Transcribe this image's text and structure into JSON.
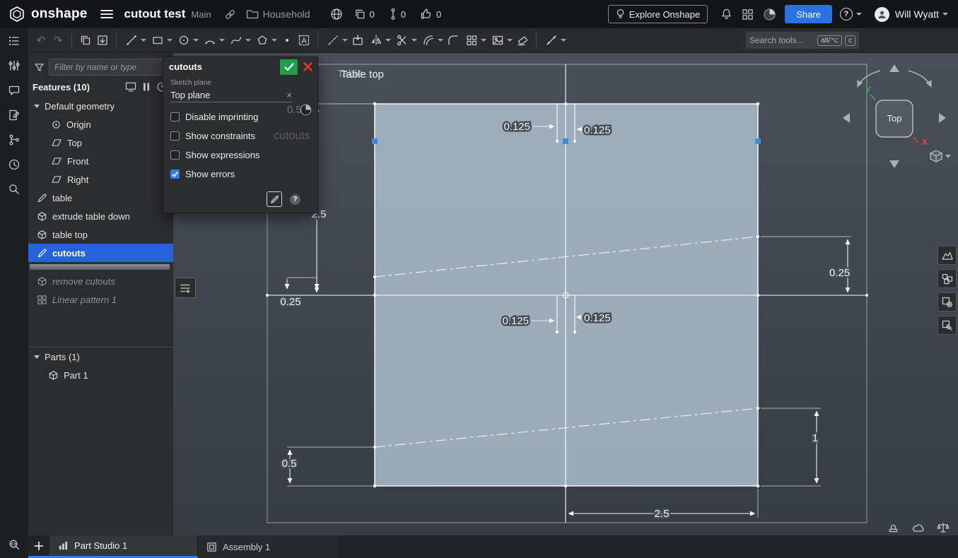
{
  "icons": {
    "undo": "↶",
    "redo": "↷",
    "text_tool": "A",
    "help": "?",
    "close": "×"
  },
  "topbar": {
    "logo_text": "onshape",
    "doc_title": "cutout test",
    "branch": "Main",
    "folder": "Household",
    "copies_count": "0",
    "versions_count": "0",
    "likes_count": "0",
    "explore_label": "Explore Onshape",
    "share_label": "Share",
    "user_name": "Will Wyatt"
  },
  "toolbar": {
    "search_placeholder": "Search tools...",
    "shortcut_alt": "alt/⌥",
    "shortcut_key": "c"
  },
  "left_tree": {
    "filter_placeholder": "Filter by name or type",
    "features_header": "Features (10)",
    "default_geometry_label": "Default geometry",
    "parts_label": "Parts (1)",
    "items": [
      {
        "label": "Origin"
      },
      {
        "label": "Top"
      },
      {
        "label": "Front"
      },
      {
        "label": "Right"
      },
      {
        "label": "table"
      },
      {
        "label": "extrude table down"
      },
      {
        "label": "table top"
      },
      {
        "label": "cutouts",
        "selected": true
      },
      {
        "label": "remove cutouts",
        "suppressed": true
      },
      {
        "label": "Linear pattern 1",
        "suppressed": true
      },
      {
        "label": "Part 1"
      }
    ]
  },
  "dialog": {
    "title": "cutouts",
    "plane_field_label": "Sketch plane",
    "plane_field_value": "Top plane",
    "checkboxes": [
      {
        "label": "Disable imprinting",
        "checked": false
      },
      {
        "label": "Show constraints",
        "checked": false
      },
      {
        "label": "Show expressions",
        "checked": false
      },
      {
        "label": "Show errors",
        "checked": true
      }
    ]
  },
  "viewport": {
    "face_label": "Table top",
    "face_label_ghost": "Table",
    "ghost_dim": "0.5",
    "ghost_sketch_label": "cutouts",
    "view_cube_face": "Top",
    "axis_x": "X",
    "axis_y": "Y",
    "dimensions": {
      "slot_top_left": "0.125",
      "slot_top_right": "0.125",
      "left_height": "2.5",
      "left_offset": "0.25",
      "slot_mid_left": "0.125",
      "slot_mid_right": "0.125",
      "right_offset": "0.25",
      "right_height": "1",
      "bottom_offset": "0.5",
      "bottom_width": "2.5"
    }
  },
  "bottom_tabs": {
    "part_studio": "Part Studio 1",
    "assembly": "Assembly 1"
  }
}
